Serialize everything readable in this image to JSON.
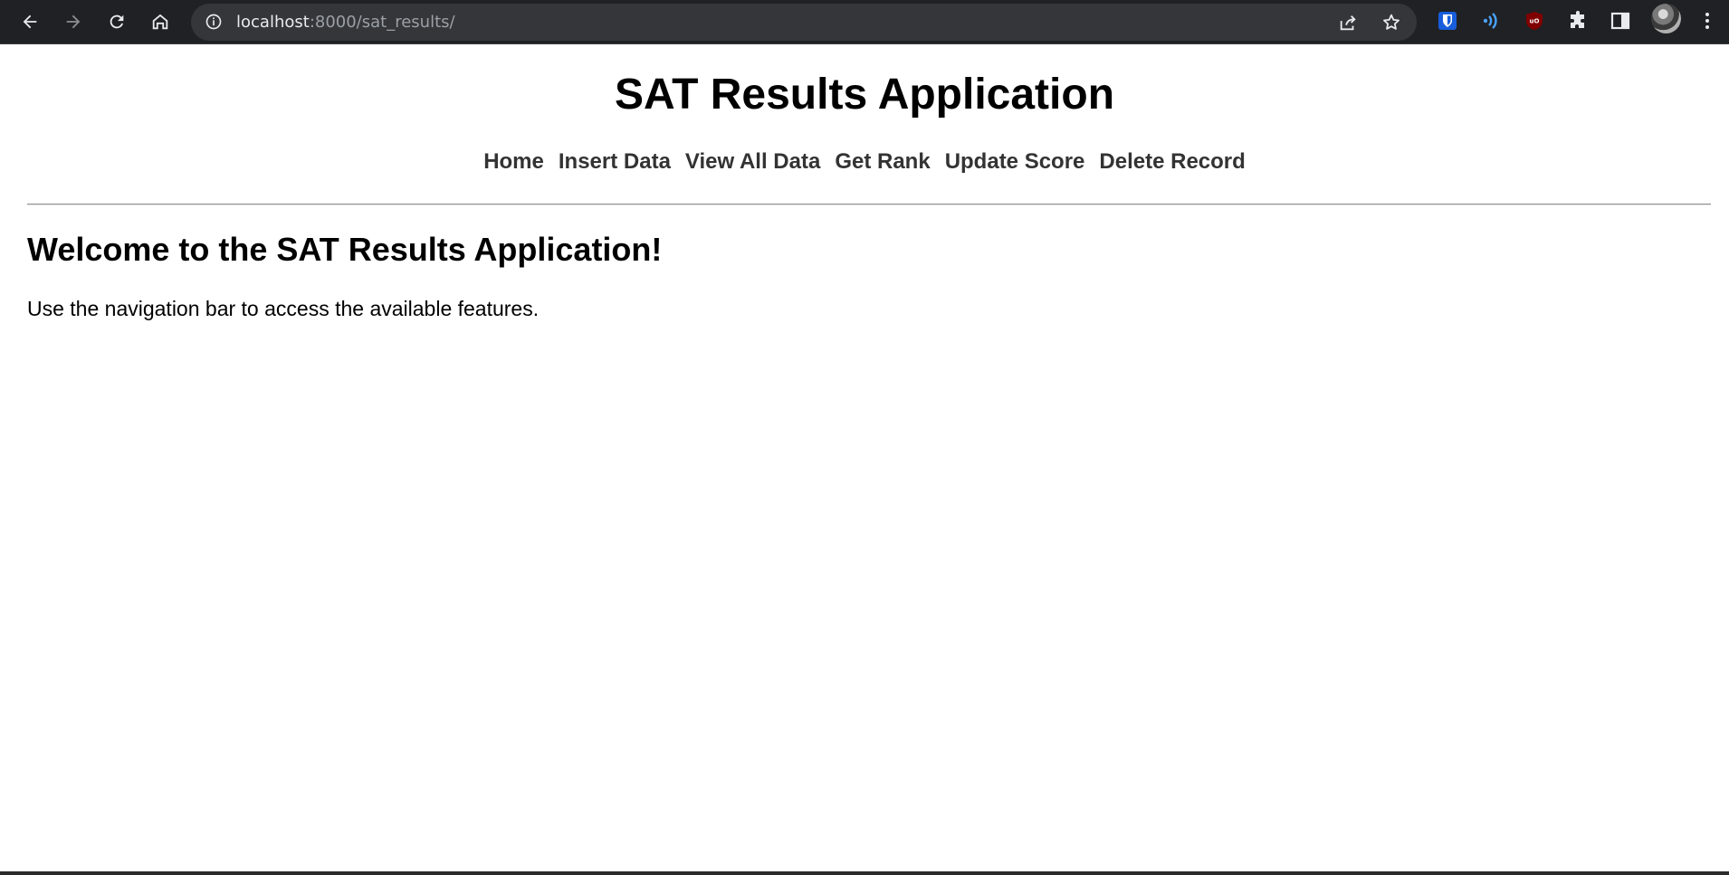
{
  "browser": {
    "url_host": "localhost",
    "url_rest": ":8000/sat_results/",
    "icons": [
      "back-icon",
      "forward-icon",
      "reload-icon",
      "home-icon",
      "site-info-icon",
      "share-icon",
      "bookmark-star-icon",
      "bitwarden-extension-icon",
      "audio-extension-icon",
      "ublock-extension-icon",
      "extensions-puzzle-icon",
      "side-panel-icon",
      "profile-avatar",
      "menu-kebab-icon"
    ],
    "colors": {
      "chrome_bg": "#202124",
      "omnibox_bg": "#35363a",
      "icon": "#e8eaed",
      "bitwarden": "#175ddc",
      "ublock": "#800000"
    }
  },
  "header": {
    "title": "SAT Results Application",
    "nav": [
      {
        "label": "Home"
      },
      {
        "label": "Insert Data"
      },
      {
        "label": "View All Data"
      },
      {
        "label": "Get Rank"
      },
      {
        "label": "Update Score"
      },
      {
        "label": "Delete Record"
      }
    ]
  },
  "main": {
    "heading": "Welcome to the SAT Results Application!",
    "intro": "Use the navigation bar to access the available features."
  }
}
